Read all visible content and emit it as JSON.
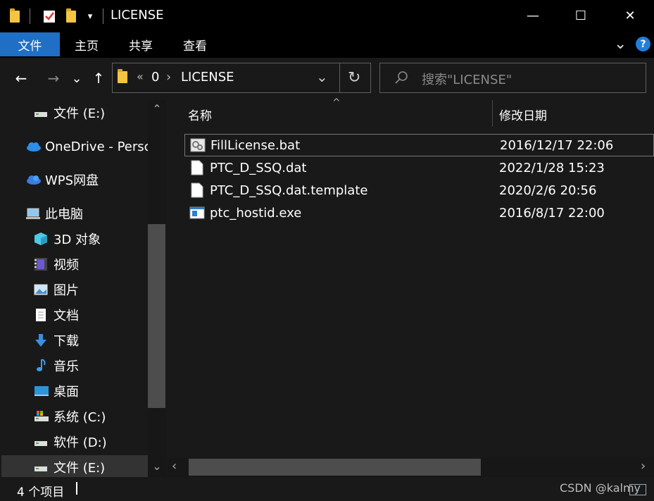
{
  "window": {
    "title": "LICENSE",
    "minimize": "—",
    "maximize": "☐",
    "close": "✕",
    "dropdown": "▾"
  },
  "ribbon": {
    "tabs": [
      "文件",
      "主页",
      "共享",
      "查看"
    ],
    "expand": "⌄",
    "help": "?"
  },
  "nav": {
    "back": "←",
    "forward": "→",
    "recent": "⌄",
    "up": "↑",
    "breadcrumb_overflow": "«",
    "breadcrumb": [
      "0",
      "LICENSE"
    ],
    "breadcrumb_sep": "›",
    "refresh": "↻",
    "addr_dropdown": "⌄",
    "search_placeholder": "搜索\"LICENSE\""
  },
  "sidebar": {
    "items": [
      {
        "label": "文件 (E:)",
        "icon": "drive-icon"
      },
      {
        "label": "OneDrive - Persc",
        "icon": "cloud-icon"
      },
      {
        "label": "WPS网盘",
        "icon": "cloud-icon"
      },
      {
        "label": "此电脑",
        "icon": "computer-icon"
      },
      {
        "label": "3D 对象",
        "icon": "cube-icon"
      },
      {
        "label": "视频",
        "icon": "video-icon"
      },
      {
        "label": "图片",
        "icon": "picture-icon"
      },
      {
        "label": "文档",
        "icon": "document-icon"
      },
      {
        "label": "下载",
        "icon": "download-icon"
      },
      {
        "label": "音乐",
        "icon": "music-icon"
      },
      {
        "label": "桌面",
        "icon": "desktop-icon"
      },
      {
        "label": "系统 (C:)",
        "icon": "drive-icon"
      },
      {
        "label": "软件 (D:)",
        "icon": "drive-icon"
      },
      {
        "label": "文件 (E:)",
        "icon": "drive-icon"
      }
    ],
    "scroll_up": "⌃",
    "scroll_down": "⌄"
  },
  "list": {
    "columns": [
      "名称",
      "修改日期"
    ],
    "sort_indicator": "^",
    "rows": [
      {
        "name": "FillLicense.bat",
        "date": "2016/12/17 22:06",
        "icon": "batch-file-icon"
      },
      {
        "name": "PTC_D_SSQ.dat",
        "date": "2022/1/28 15:23",
        "icon": "file-icon"
      },
      {
        "name": "PTC_D_SSQ.dat.template",
        "date": "2020/2/6 20:56",
        "icon": "file-icon"
      },
      {
        "name": "ptc_hostid.exe",
        "date": "2016/8/17 22:00",
        "icon": "exe-icon"
      }
    ],
    "scroll_left": "‹",
    "scroll_right": "›"
  },
  "status": {
    "count": "4 个项目",
    "watermark": "CSDN @kalmy"
  },
  "colors": {
    "accent": "#1f6fc5",
    "background": "#191919",
    "titlebar": "#000000"
  }
}
